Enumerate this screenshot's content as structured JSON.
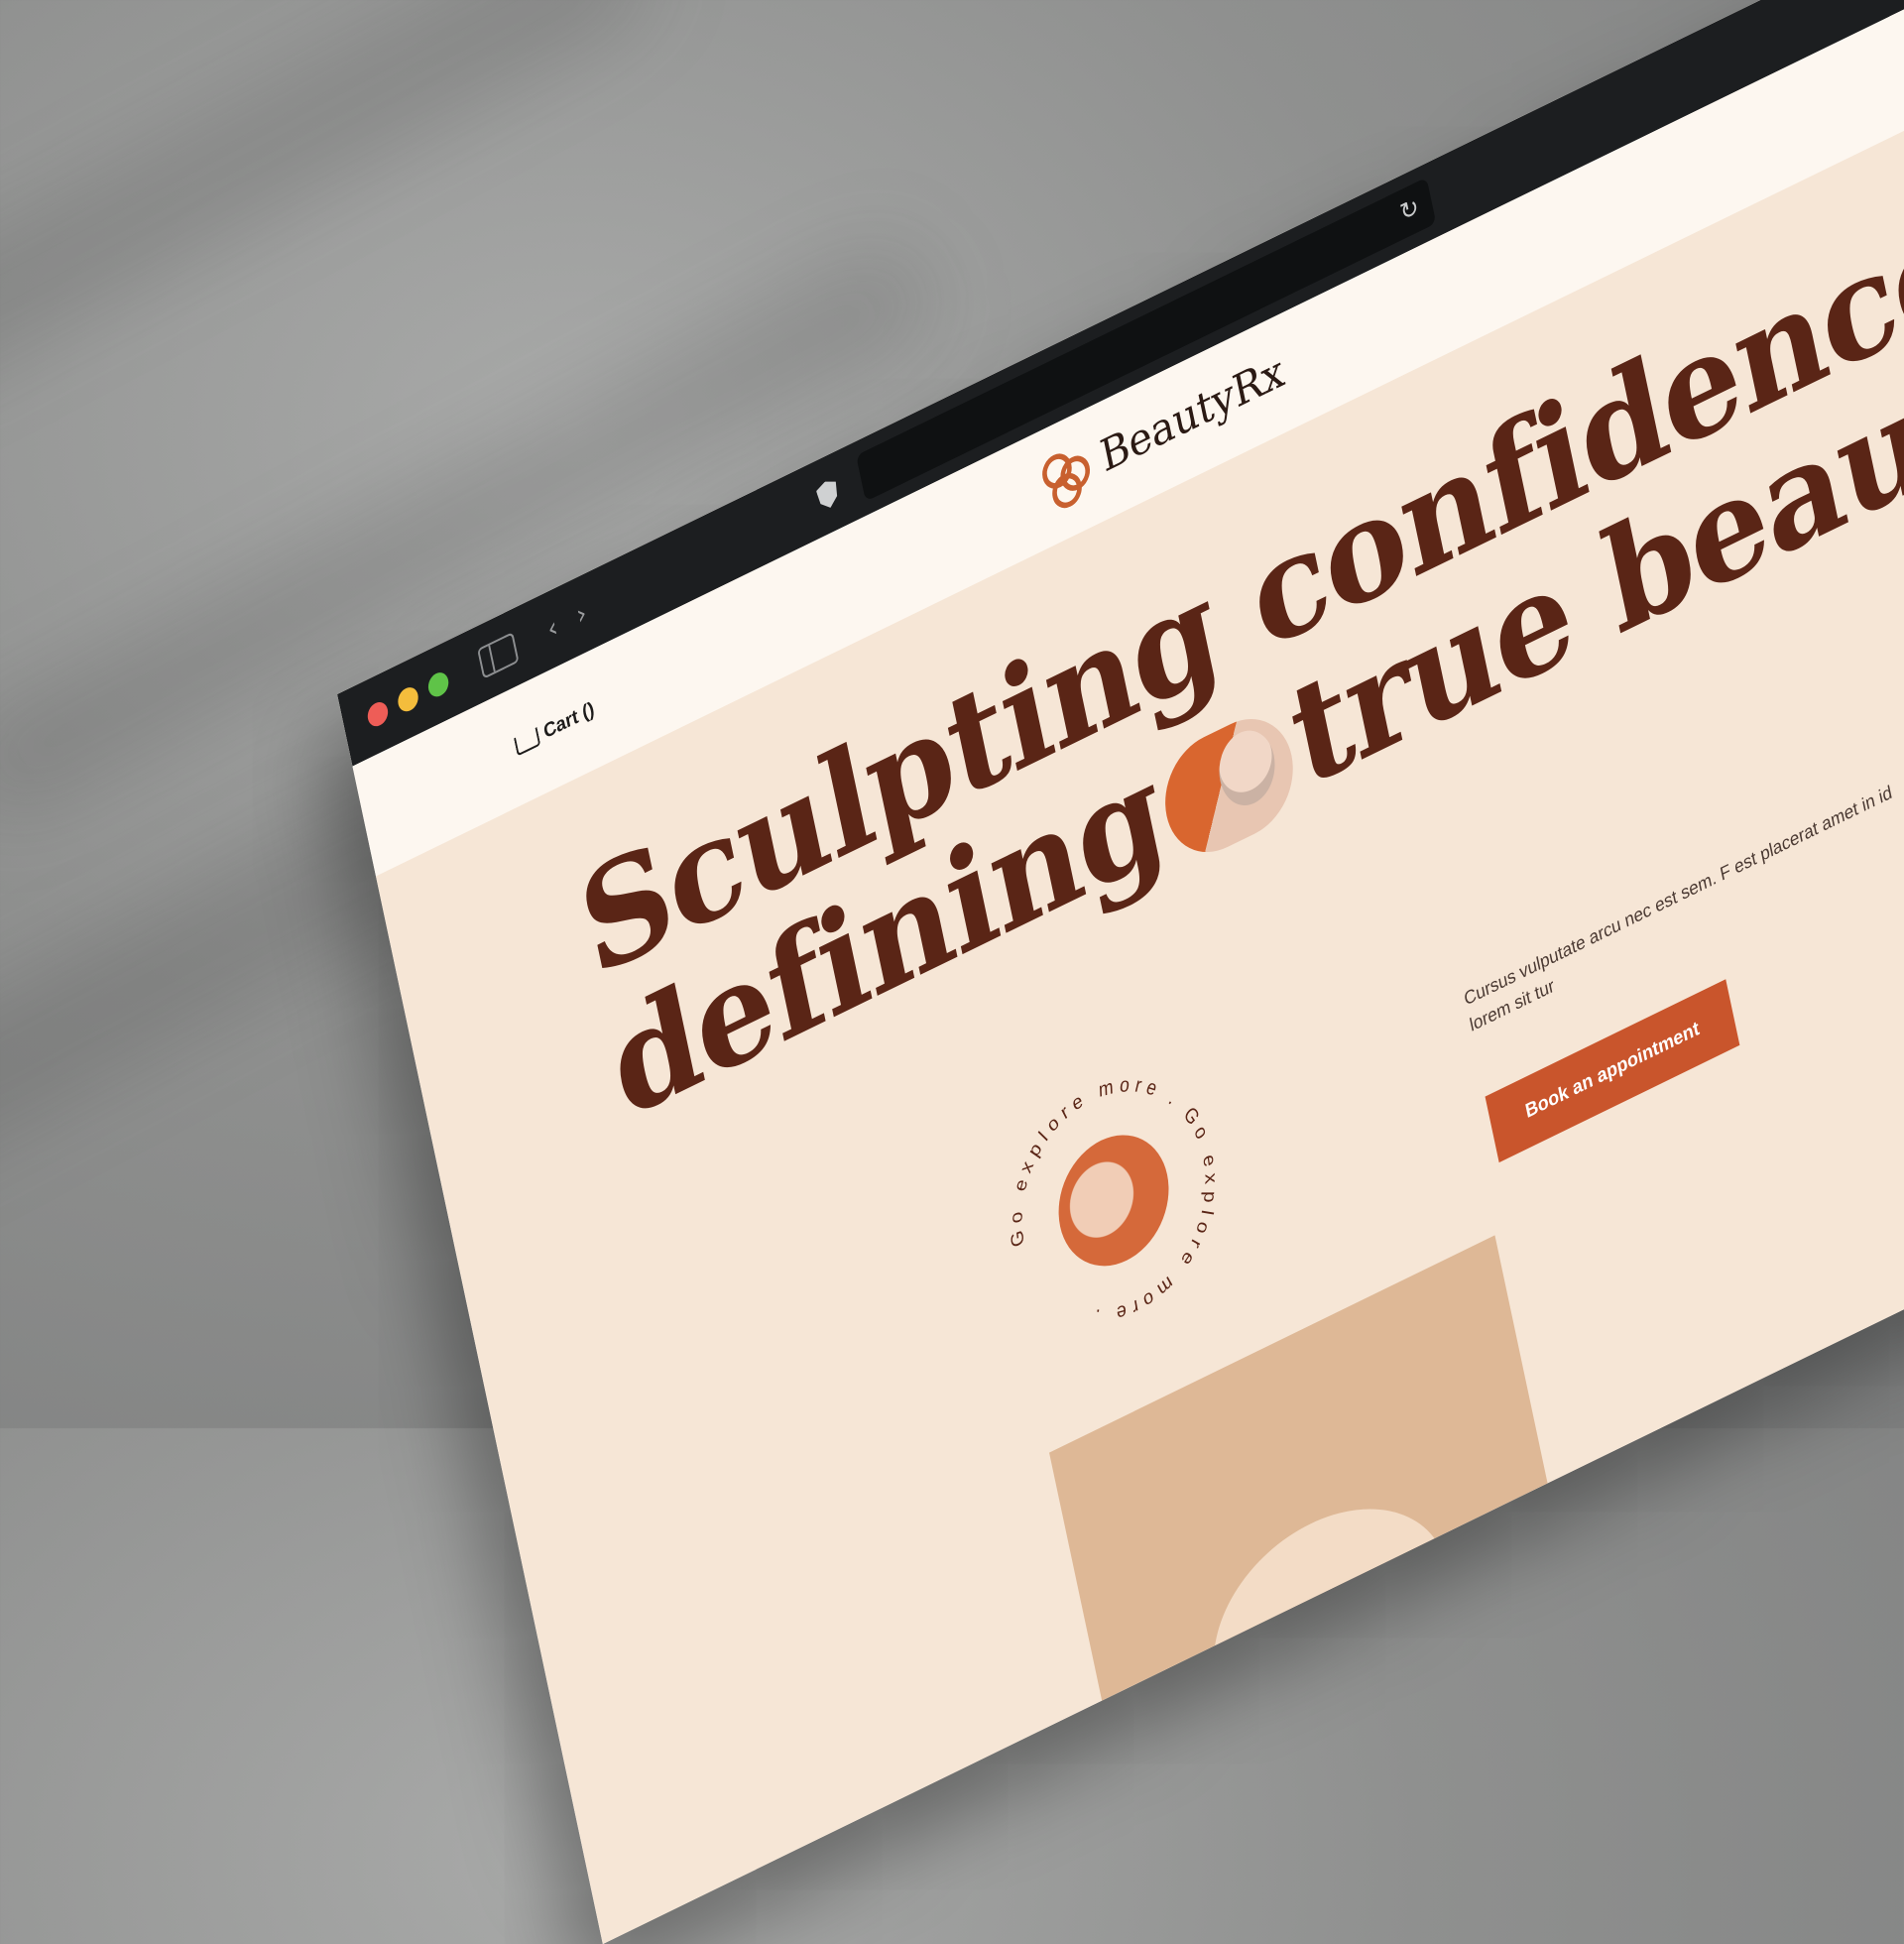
{
  "browser": {
    "window_controls": [
      "close",
      "minimize",
      "zoom"
    ],
    "icons": [
      "sidebar-icon",
      "back-icon",
      "forward-icon",
      "shield-icon",
      "reload-icon"
    ]
  },
  "header": {
    "cart_label": "Cart ()",
    "brand": "BeautyRx"
  },
  "hero": {
    "headline_line1": "Sculpting confidence",
    "headline_line2_a": "defining",
    "headline_line2_b": "true beauty",
    "explore_badge": "Go explore more . Go explore more .",
    "copy": "Cursus vulputate arcu nec est sem. F est placerat amet in id lorem sit tur",
    "cta": "Book an appointment"
  },
  "colors": {
    "accent": "#c9552c",
    "headline": "#5a2516",
    "hero_bg": "#f6e6d6",
    "header_bg": "#fdf7f0",
    "titlebar": "#1c1e20"
  }
}
